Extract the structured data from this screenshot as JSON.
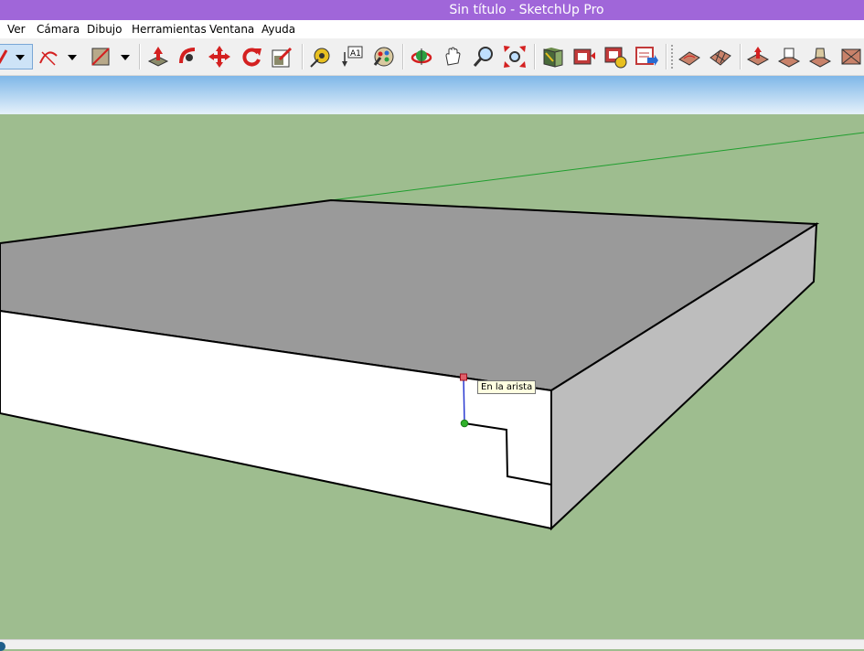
{
  "window": {
    "title": "Sin título - SketchUp Pro"
  },
  "menu": [
    {
      "label": "Ver"
    },
    {
      "label": "Cámara"
    },
    {
      "label": "Dibujo"
    },
    {
      "label": "Herramientas"
    },
    {
      "label": "Ventana"
    },
    {
      "label": "Ayuda"
    }
  ],
  "toolbar": {
    "tools": [
      {
        "name": "line-tool-icon"
      },
      {
        "name": "arc-tool-icon"
      },
      {
        "name": "rectangle-tool-icon"
      },
      {
        "name": "push-pull-icon"
      },
      {
        "name": "follow-me-icon"
      },
      {
        "name": "move-icon"
      },
      {
        "name": "rotate-icon"
      },
      {
        "name": "scale-icon"
      },
      {
        "name": "tape-measure-icon"
      },
      {
        "name": "text-icon"
      },
      {
        "name": "paint-bucket-icon"
      },
      {
        "name": "orbit-icon"
      },
      {
        "name": "pan-icon"
      },
      {
        "name": "zoom-icon"
      },
      {
        "name": "zoom-extents-icon"
      },
      {
        "name": "warehouse-icon"
      },
      {
        "name": "share-model-icon"
      },
      {
        "name": "get-models-icon"
      },
      {
        "name": "extension-icon"
      },
      {
        "name": "sandbox-from-contours-icon"
      },
      {
        "name": "sandbox-from-scratch-icon"
      },
      {
        "name": "smoove-icon"
      },
      {
        "name": "stamp-icon"
      },
      {
        "name": "drape-icon"
      },
      {
        "name": "add-detail-icon"
      },
      {
        "name": "flip-edge-icon"
      }
    ]
  },
  "viewport": {
    "colors": {
      "ground": "#9ebd8f",
      "top_face": "#9a9a9a",
      "side_face": "#bdbdbd",
      "front_face": "#ffffff",
      "green_axis": "#1f9e2e"
    },
    "inference_tooltip": "En la arista"
  }
}
